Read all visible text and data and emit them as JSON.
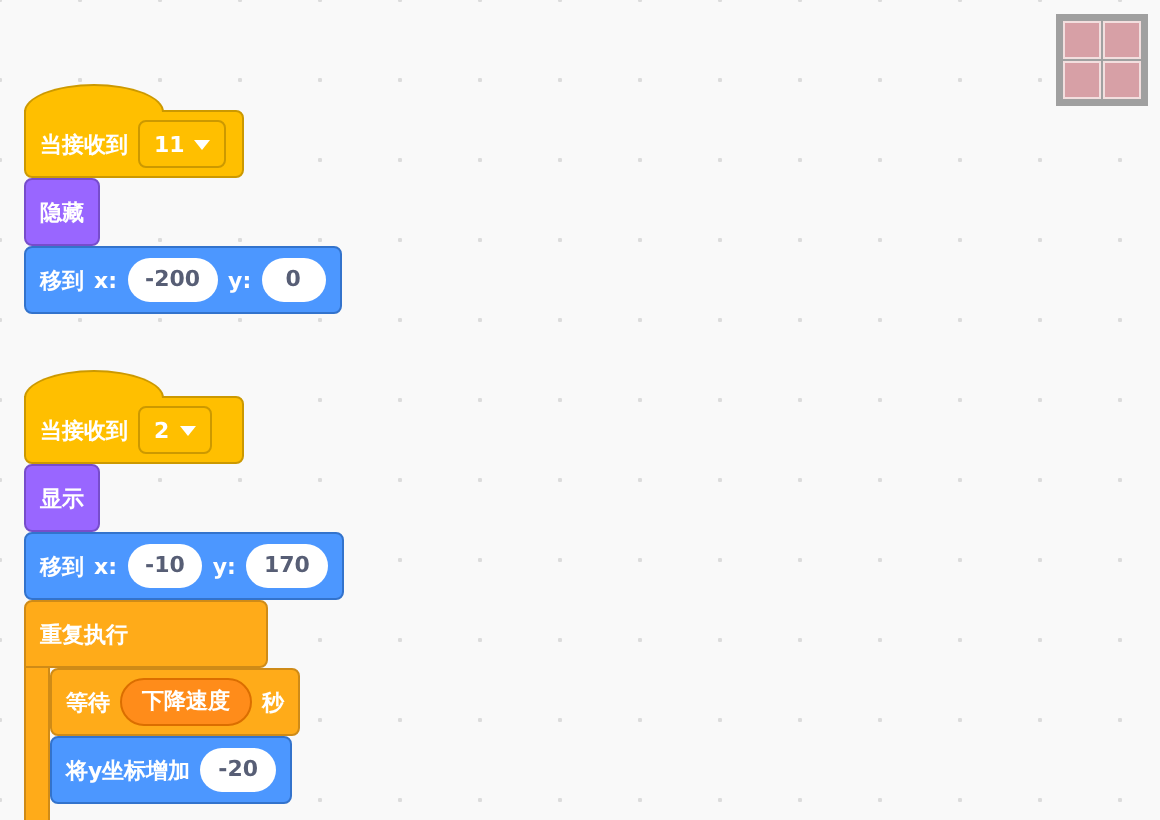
{
  "scripts": [
    {
      "hat": {
        "kind": "event",
        "parts": [
          {
            "kind": "text",
            "text": "当接收到"
          },
          {
            "kind": "dropdown",
            "text": "11"
          }
        ]
      },
      "blocks": [
        {
          "kind": "looks",
          "parts": [
            {
              "kind": "text",
              "text": "隐藏"
            }
          ]
        },
        {
          "kind": "motion",
          "parts": [
            {
              "kind": "text",
              "text": "移到"
            },
            {
              "kind": "text",
              "text": "x:"
            },
            {
              "kind": "number",
              "text": "-200"
            },
            {
              "kind": "text",
              "text": "y:"
            },
            {
              "kind": "number",
              "text": "0"
            }
          ]
        }
      ]
    },
    {
      "hat": {
        "kind": "event",
        "parts": [
          {
            "kind": "text",
            "text": "当接收到"
          },
          {
            "kind": "dropdown",
            "text": "2"
          }
        ]
      },
      "blocks": [
        {
          "kind": "looks",
          "parts": [
            {
              "kind": "text",
              "text": "显示"
            }
          ]
        },
        {
          "kind": "motion",
          "parts": [
            {
              "kind": "text",
              "text": "移到"
            },
            {
              "kind": "text",
              "text": "x:"
            },
            {
              "kind": "number",
              "text": "-10"
            },
            {
              "kind": "text",
              "text": "y:"
            },
            {
              "kind": "number",
              "text": "170"
            }
          ]
        },
        {
          "kind": "control",
          "parts": [
            {
              "kind": "text",
              "text": "重复执行"
            }
          ],
          "children": [
            {
              "kind": "control",
              "parts": [
                {
                  "kind": "text",
                  "text": "等待"
                },
                {
                  "kind": "reporter",
                  "text": "下降速度"
                },
                {
                  "kind": "text",
                  "text": "秒"
                }
              ]
            },
            {
              "kind": "motion",
              "parts": [
                {
                  "kind": "text",
                  "text": "将y坐标增加"
                },
                {
                  "kind": "number",
                  "text": "-20"
                }
              ]
            }
          ]
        }
      ]
    }
  ]
}
